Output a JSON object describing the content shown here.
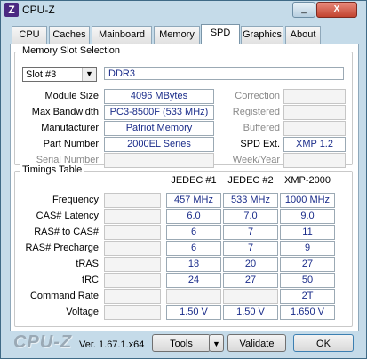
{
  "window": {
    "title": "CPU-Z",
    "icon_letter": "Z",
    "minimize": "_",
    "close": "X"
  },
  "tabs": [
    "CPU",
    "Caches",
    "Mainboard",
    "Memory",
    "SPD",
    "Graphics",
    "About"
  ],
  "active_tab": "SPD",
  "memory_slot": {
    "group_title": "Memory Slot Selection",
    "slot": "Slot #3",
    "type": "DDR3",
    "labels": {
      "module_size": "Module Size",
      "max_bandwidth": "Max Bandwidth",
      "manufacturer": "Manufacturer",
      "part_number": "Part Number",
      "serial_number": "Serial Number",
      "correction": "Correction",
      "registered": "Registered",
      "buffered": "Buffered",
      "spd_ext": "SPD Ext.",
      "week_year": "Week/Year"
    },
    "values": {
      "module_size": "4096 MBytes",
      "max_bandwidth": "PC3-8500F (533 MHz)",
      "manufacturer": "Patriot Memory",
      "part_number": "2000EL Series",
      "serial_number": "",
      "correction": "",
      "registered": "",
      "buffered": "",
      "spd_ext": "XMP 1.2",
      "week_year": ""
    }
  },
  "timings": {
    "group_title": "Timings Table",
    "columns": [
      "JEDEC #1",
      "JEDEC #2",
      "XMP-2000"
    ],
    "rows": [
      {
        "label": "Frequency",
        "values": [
          "457 MHz",
          "533 MHz",
          "1000 MHz"
        ]
      },
      {
        "label": "CAS# Latency",
        "values": [
          "6.0",
          "7.0",
          "9.0"
        ]
      },
      {
        "label": "RAS# to CAS#",
        "values": [
          "6",
          "7",
          "11"
        ]
      },
      {
        "label": "RAS# Precharge",
        "values": [
          "6",
          "7",
          "9"
        ]
      },
      {
        "label": "tRAS",
        "values": [
          "18",
          "20",
          "27"
        ]
      },
      {
        "label": "tRC",
        "values": [
          "24",
          "27",
          "50"
        ]
      },
      {
        "label": "Command Rate",
        "values": [
          "",
          "",
          "2T"
        ]
      },
      {
        "label": "Voltage",
        "values": [
          "1.50 V",
          "1.50 V",
          "1.650 V"
        ]
      }
    ]
  },
  "footer": {
    "logo": "CPU-Z",
    "version": "Ver. 1.67.1.x64",
    "tools": "Tools",
    "validate": "Validate",
    "ok": "OK"
  }
}
